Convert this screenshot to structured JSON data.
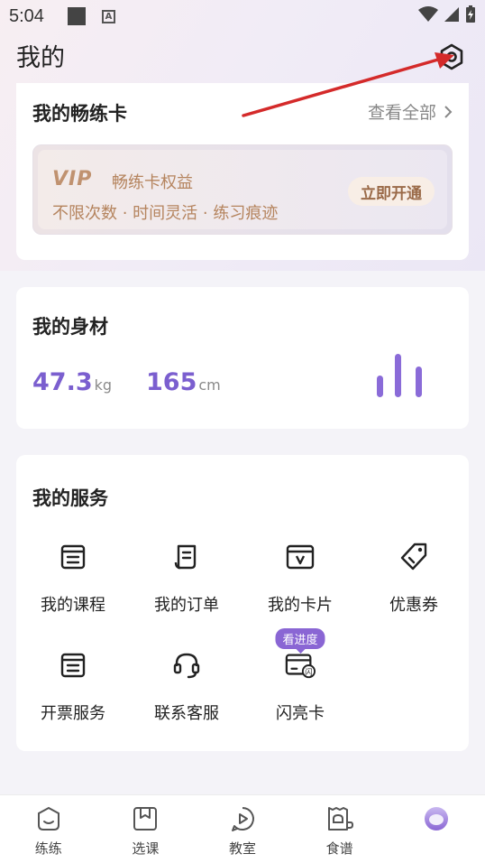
{
  "status_bar": {
    "time": "5:04",
    "notification_icons": [
      "square-icon",
      "a-icon"
    ],
    "right_icons": [
      "wifi-icon",
      "signal-icon",
      "battery-charging-icon"
    ]
  },
  "header": {
    "title": "我的",
    "settings_icon": "settings-icon"
  },
  "membership": {
    "title": "我的畅练卡",
    "view_all": "查看全部",
    "vip_logo": "VIP",
    "benefit_title": "畅练卡权益",
    "benefit_subtitle": "不限次数 · 时间灵活 · 练习痕迹",
    "cta": "立即开通"
  },
  "body_info": {
    "title": "我的身材",
    "weight_value": "47.3",
    "weight_unit": "kg",
    "height_value": "165",
    "height_unit": "cm",
    "chart_icon": "bar-chart-icon"
  },
  "services": {
    "title": "我的服务",
    "items": [
      {
        "label": "我的课程",
        "icon": "course-icon"
      },
      {
        "label": "我的订单",
        "icon": "order-icon"
      },
      {
        "label": "我的卡片",
        "icon": "card-icon"
      },
      {
        "label": "优惠券",
        "icon": "coupon-icon"
      },
      {
        "label": "开票服务",
        "icon": "invoice-icon"
      },
      {
        "label": "联系客服",
        "icon": "headset-icon"
      },
      {
        "label": "闪亮卡",
        "icon": "flash-card-icon",
        "badge": "看进度"
      }
    ]
  },
  "bottom_nav": [
    {
      "label": "练练",
      "icon": "practice-icon"
    },
    {
      "label": "选课",
      "icon": "choose-course-icon"
    },
    {
      "label": "教室",
      "icon": "classroom-icon"
    },
    {
      "label": "食谱",
      "icon": "recipe-icon"
    },
    {
      "label": "",
      "icon": "profile-avatar-icon",
      "active": true
    }
  ],
  "colors": {
    "accent": "#7b5fcf",
    "vip_gold": "#b5845e",
    "annotation_arrow": "#d42a2a"
  }
}
